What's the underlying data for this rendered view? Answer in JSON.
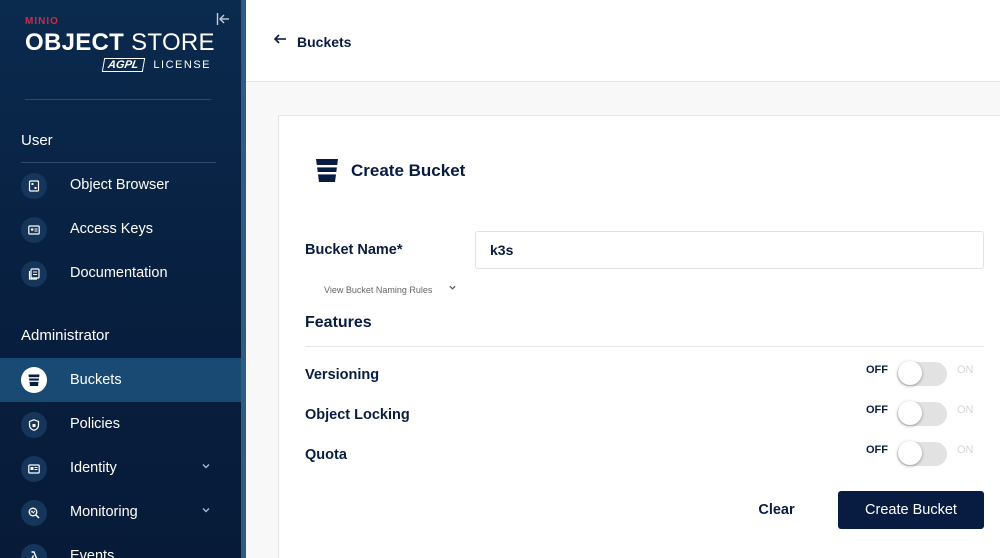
{
  "logo": {
    "brand": "MINIO",
    "title_bold": "OBJECT",
    "title_light": "STORE",
    "badge": "AGPL",
    "license": "LICENSE"
  },
  "sidebar": {
    "sections": [
      {
        "label": "User"
      },
      {
        "label": "Administrator"
      }
    ],
    "items": [
      {
        "label": "Object Browser",
        "icon": "object-browser-icon"
      },
      {
        "label": "Access Keys",
        "icon": "access-keys-icon"
      },
      {
        "label": "Documentation",
        "icon": "documentation-icon"
      },
      {
        "label": "Buckets",
        "icon": "bucket-icon",
        "active": true
      },
      {
        "label": "Policies",
        "icon": "shield-icon"
      },
      {
        "label": "Identity",
        "icon": "id-card-icon",
        "expandable": true
      },
      {
        "label": "Monitoring",
        "icon": "monitoring-icon",
        "expandable": true
      },
      {
        "label": "Events",
        "icon": "lambda-icon"
      }
    ]
  },
  "header": {
    "back_label": "Buckets"
  },
  "form": {
    "title": "Create Bucket",
    "bucket_name_label": "Bucket Name*",
    "bucket_name_value": "k3s",
    "naming_rules_label": "View Bucket Naming Rules",
    "features_title": "Features",
    "features": [
      {
        "label": "Versioning",
        "off_label": "OFF",
        "on_label": "ON",
        "enabled": false
      },
      {
        "label": "Object Locking",
        "off_label": "OFF",
        "on_label": "ON",
        "enabled": false
      },
      {
        "label": "Quota",
        "off_label": "OFF",
        "on_label": "ON",
        "enabled": false
      }
    ],
    "clear_label": "Clear",
    "submit_label": "Create Bucket"
  },
  "colors": {
    "sidebar_bg": "#0a2a4e",
    "active_item": "#184a73",
    "brand_red": "#c72c48",
    "primary": "#081c42"
  }
}
